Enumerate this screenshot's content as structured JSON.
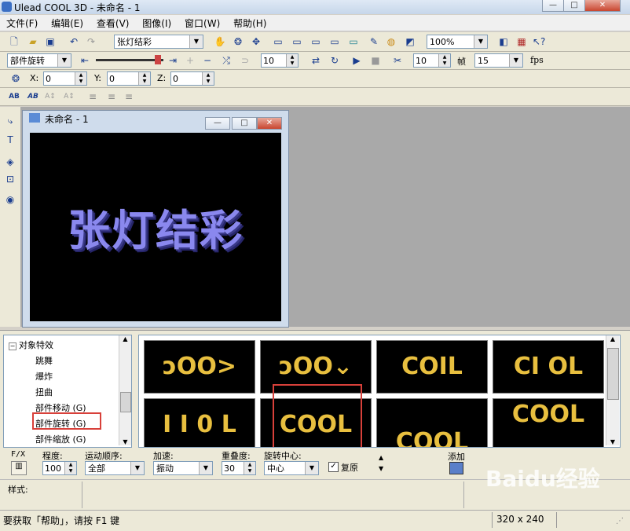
{
  "app": {
    "title": "Ulead COOL 3D - 未命名 - 1"
  },
  "window_buttons": {
    "minimize": "—",
    "maximize": "□",
    "close": "✕"
  },
  "menu": [
    "文件(F)",
    "编辑(E)",
    "查看(V)",
    "图像(I)",
    "窗口(W)",
    "帮助(H)"
  ],
  "toolbar1": {
    "object_combo": "张灯结彩",
    "zoom_combo": "100%"
  },
  "toolbar2": {
    "effect_combo": "部件旋转",
    "frame_value": "10",
    "frames_value": "10",
    "frames_label": "帧",
    "fps_value": "15",
    "fps_label": "fps"
  },
  "toolbar3": {
    "x_label": "X:",
    "x_value": "0",
    "y_label": "Y:",
    "y_value": "0",
    "z_label": "Z:",
    "z_value": "0"
  },
  "child_window": {
    "title": "未命名 - 1",
    "art_text": "张灯结彩"
  },
  "tree": {
    "root": "对象特效",
    "items": [
      "跳舞",
      "爆炸",
      "扭曲",
      "部件移动 (G)",
      "部件旋转 (G)",
      "部件缩放 (G)"
    ]
  },
  "thumbnails": [
    "ↄOO>",
    "ↄOO⌄",
    "COIL",
    "CI OL",
    "I I 0 L",
    "COOL",
    "COOL",
    "COOL"
  ],
  "properties": {
    "fx_label": "F/X",
    "degree_label": "程度:",
    "degree_value": "100",
    "order_label": "运动顺序:",
    "order_value": "全部",
    "accel_label": "加速:",
    "accel_value": "振动",
    "overlap_label": "重叠度:",
    "overlap_value": "30",
    "center_label": "旋转中心:",
    "center_value": "中心",
    "reset_label": "复原",
    "add_label": "添加"
  },
  "style_label": "样式:",
  "status": {
    "help_text": "要获取「帮助」，请按 F1 键",
    "size_text": "320 x 240"
  },
  "watermark": "Baidu经验"
}
